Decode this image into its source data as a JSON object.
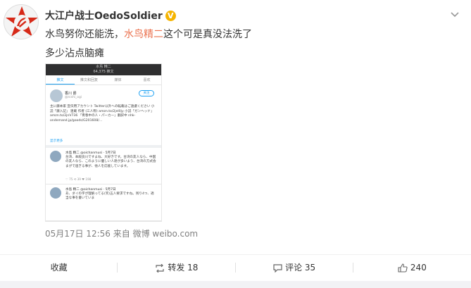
{
  "post": {
    "username": "大江户战士OedoSoldier",
    "verified_mark": "V",
    "line1_prefix": "水鸟努你还能洗，",
    "line1_link": "水鸟精二",
    "line1_suffix": "这个可是真没法洗了",
    "line2": "多少沾点脑瘫",
    "meta": "05月17日 12:56  来自 微博 weibo.com"
  },
  "screenshot": {
    "header_name": "水島 精二",
    "header_sub": "64,375 推文",
    "tabs": [
      {
        "label": "推文"
      },
      {
        "label": "推文和回复"
      },
      {
        "label": "媒体"
      },
      {
        "label": "喜欢"
      }
    ],
    "profile_name": "香川 爵",
    "profile_handle": "@nishi_ogi",
    "follow_label": "关注",
    "bio": "主に藤本家 宣伝用アカウント Twitter以外への転載はご遠慮ください 小説「藤入記」 連載 作者 (三人称) amzn.to/2jeI0jy 小説「ガンヘッド」amzn.to/2jnV736 「青春中の人・パーカー」翻訳中 nhk-ondemand.jp/goods/G201608/...",
    "show_more": "显示更多",
    "tweets": [
      {
        "name": "水島 精二 @oichanmusi · 5月7日",
        "text": "台湾、本殿良川ですよね、大好きです。台湾の友人なら、中国の友人なら、このように優しい人達が多いよう、台湾の方式会まがで過ぎる事が、他人を応援しています。",
        "actions": "♡ 75    ⟲ 39    ♥ 198"
      },
      {
        "name": "水島 精二 @oichanmusi · 5月7日",
        "text": "あ、ダイの字が理解ってる(笑)五人要求ですね。残り4つ、適当な事を書いていま",
        "actions": ""
      }
    ]
  },
  "actions": {
    "favorite": "收藏",
    "repost": "转发 18",
    "comment": "评论 35",
    "like": "240"
  },
  "colors": {
    "link": "#eb7350",
    "badge": "#f5b400",
    "twitter_blue": "#1da1f2"
  }
}
